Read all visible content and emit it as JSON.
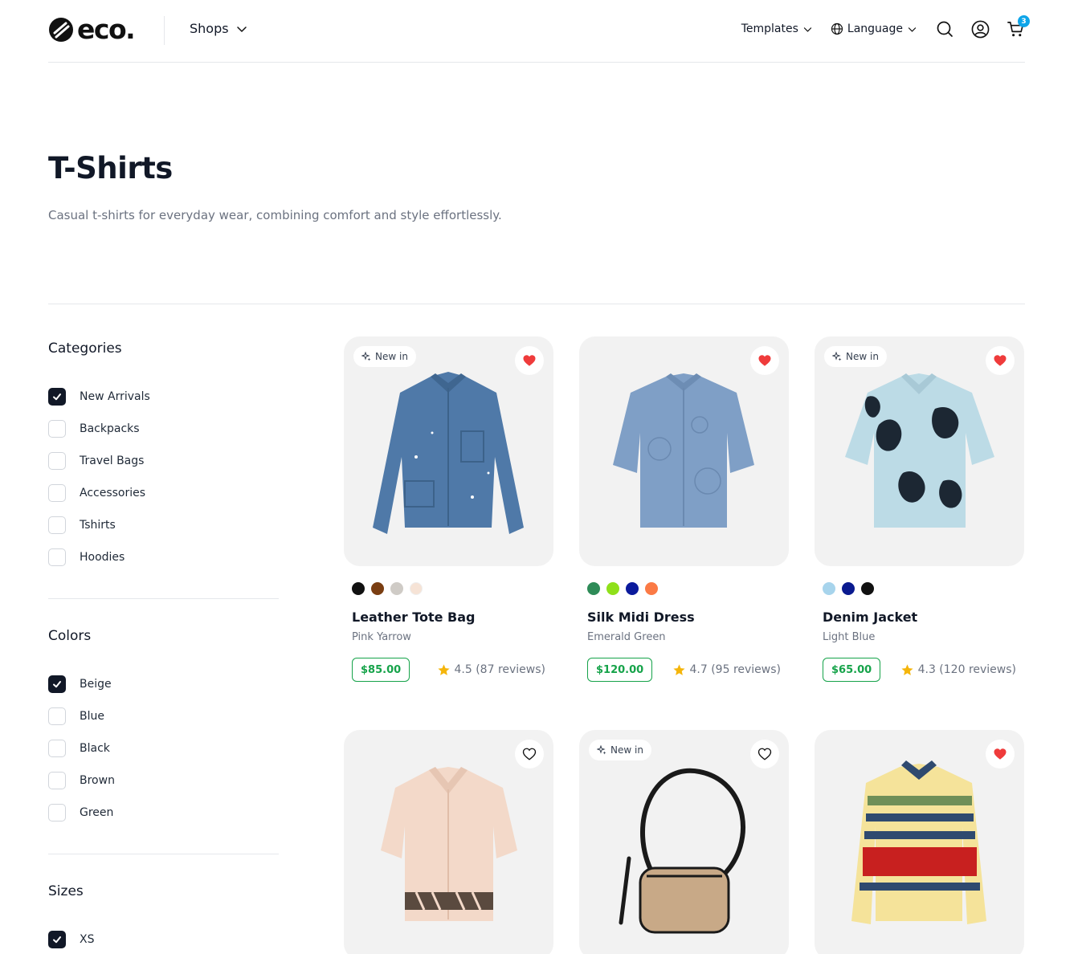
{
  "header": {
    "logo_text": "eco.",
    "shops_label": "Shops",
    "templates_label": "Templates",
    "language_label": "Language",
    "cart_count": "3"
  },
  "page": {
    "title": "T-Shirts",
    "description": "Casual t-shirts for everyday wear, combining comfort and style effortlessly."
  },
  "filters": {
    "categories": {
      "title": "Categories",
      "items": [
        {
          "label": "New Arrivals",
          "checked": true
        },
        {
          "label": "Backpacks",
          "checked": false
        },
        {
          "label": "Travel Bags",
          "checked": false
        },
        {
          "label": "Accessories",
          "checked": false
        },
        {
          "label": "Tshirts",
          "checked": false
        },
        {
          "label": "Hoodies",
          "checked": false
        }
      ]
    },
    "colors": {
      "title": "Colors",
      "items": [
        {
          "label": "Beige",
          "checked": true
        },
        {
          "label": "Blue",
          "checked": false
        },
        {
          "label": "Black",
          "checked": false
        },
        {
          "label": "Brown",
          "checked": false
        },
        {
          "label": "Green",
          "checked": false
        }
      ]
    },
    "sizes": {
      "title": "Sizes",
      "items": [
        {
          "label": "XS",
          "checked": true
        }
      ]
    }
  },
  "badge_new_label": "New in",
  "products": [
    {
      "name": "Leather Tote Bag",
      "variant": "Pink Yarrow",
      "price": "$85.00",
      "rating": "4.5 (87 reviews)",
      "new": true,
      "favorite": true,
      "swatches": [
        "#111111",
        "#7a3e12",
        "#cfcbc6",
        "#f6e3d6"
      ]
    },
    {
      "name": "Silk Midi Dress",
      "variant": "Emerald Green",
      "price": "$120.00",
      "rating": "4.7 (95 reviews)",
      "new": false,
      "favorite": true,
      "swatches": [
        "#2e8b57",
        "#8fe01a",
        "#0b1a9c",
        "#fb7a45"
      ]
    },
    {
      "name": "Denim Jacket",
      "variant": "Light Blue",
      "price": "$65.00",
      "rating": "4.3 (120 reviews)",
      "new": true,
      "favorite": true,
      "swatches": [
        "#a7d4ec",
        "#0a1a8f",
        "#111111"
      ]
    },
    {
      "name": "",
      "variant": "",
      "price": "",
      "rating": "",
      "new": false,
      "favorite": false,
      "swatches": []
    },
    {
      "name": "",
      "variant": "",
      "price": "",
      "rating": "",
      "new": true,
      "favorite": false,
      "swatches": []
    },
    {
      "name": "",
      "variant": "",
      "price": "",
      "rating": "",
      "new": false,
      "favorite": true,
      "swatches": []
    }
  ],
  "colors": {
    "price_green": "#16a34a",
    "heart_red": "#ef3b3b",
    "star": "#f5b50a",
    "badge_blue": "#0ea5e9"
  }
}
